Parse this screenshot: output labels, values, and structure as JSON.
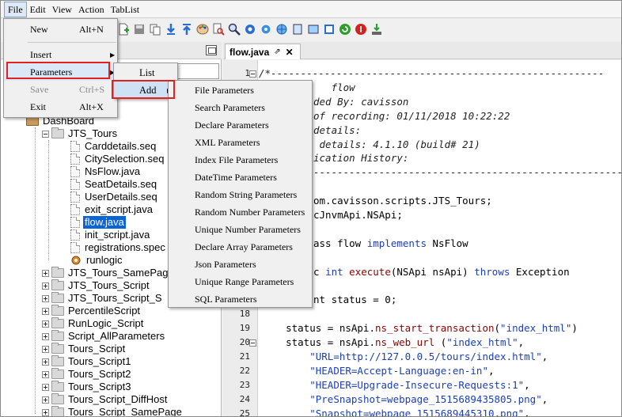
{
  "menubar": [
    "File",
    "Edit",
    "View",
    "Action",
    "TabList"
  ],
  "file_menu": {
    "items": [
      {
        "label": "New",
        "shortcut": "Alt+N",
        "enabled": true
      },
      {
        "label": "Insert",
        "shortcut": "",
        "enabled": true,
        "submenu": true
      },
      {
        "label": "Parameters",
        "shortcut": "",
        "enabled": true,
        "submenu": true,
        "highlighted": true
      },
      {
        "label": "Save",
        "shortcut": "Ctrl+S",
        "enabled": false
      },
      {
        "label": "Exit",
        "shortcut": "Alt+X",
        "enabled": true
      }
    ]
  },
  "parameters_submenu": {
    "items": [
      {
        "label": "List"
      },
      {
        "label": "Add",
        "submenu": true,
        "highlighted": true
      }
    ]
  },
  "add_submenu": {
    "items": [
      "File Parameters",
      "Search Parameters",
      "Declare Parameters",
      "XML Parameters",
      "Index File Parameters",
      "DateTime Parameters",
      "Random String Parameters",
      "Random Number Parameters",
      "Unique Number Parameters",
      "Declare Array Parameters",
      "Json Parameters",
      "Unique Range Parameters",
      "SQL Parameters"
    ]
  },
  "toolbar_icons": [
    "new-file-icon",
    "save-icon",
    "copy-icon",
    "download-icon",
    "upload-icon",
    "palette-icon",
    "search-document-icon",
    "search-icon",
    "settings-icon",
    "globe-icon",
    "web-icon",
    "document-icon",
    "image-icon",
    "message-icon",
    "refresh-icon",
    "stop-icon",
    "export-icon"
  ],
  "tree": {
    "root": "DashBoard",
    "folder": "JTS_Tours",
    "files": [
      "Carddetails.seq",
      "CitySelection.seq",
      "NsFlow.java",
      "SeatDetails.seq",
      "UserDetails.seq",
      "exit_script.java",
      "flow.java",
      "init_script.java",
      "registrations.spec",
      "runlogic"
    ],
    "selected": "flow.java",
    "other_folders": [
      "JTS_Tours_SamePage",
      "JTS_Tours_Script",
      "JTS_Tours_Script_S",
      "PercentileScript",
      "RunLogic_Script",
      "Script_AllParameters",
      "Tours_Script",
      "Tours_Script1",
      "Tours_Script2",
      "Tours_Script3",
      "Tours_Script_DiffHost",
      "Tours_Script_SamePage"
    ]
  },
  "editor": {
    "tab_title": "flow.java",
    "tab_pin": "⇗",
    "tab_close": "✕",
    "lines": [
      {
        "n": "1",
        "text": "/*--------------------------------------------------------"
      },
      {
        "n": "",
        "text": "   flow"
      },
      {
        "n": "",
        "text": "ded By: cavisson"
      },
      {
        "n": "",
        "text": "of recording: 01/11/2018 10:22:22"
      },
      {
        "n": "",
        "text": "details:"
      },
      {
        "n": "",
        "text": " details: 4.1.10 (build# 21)"
      },
      {
        "n": "",
        "text": "ication History:"
      },
      {
        "n": "",
        "text": "--------------------------------------------------------"
      },
      {
        "n": "",
        "text": ""
      },
      {
        "n": "",
        "text": "om.cavisson.scripts.JTS_Tours;"
      },
      {
        "n": "",
        "text": "cJnvmApi.NSApi;"
      },
      {
        "n": "",
        "text": ""
      },
      {
        "n": "",
        "text": "ass flow implements NsFlow"
      },
      {
        "n": "",
        "text": ""
      },
      {
        "n": "",
        "text": "c int execute(NSApi nsApi) throws Exception"
      },
      {
        "n": "",
        "text": ""
      },
      {
        "n": "",
        "text": "nt status = 0;"
      },
      {
        "n": "18",
        "text": ""
      },
      {
        "n": "19",
        "text": "    status = nsApi.ns_start_transaction(\"index_html\")"
      },
      {
        "n": "20",
        "text": "    status = nsApi.ns_web_url (\"index_html\","
      },
      {
        "n": "21",
        "text": "        \"URL=http://127.0.0.5/tours/index.html\","
      },
      {
        "n": "22",
        "text": "        \"HEADER=Accept-Language:en-in\","
      },
      {
        "n": "23",
        "text": "        \"HEADER=Upgrade-Insecure-Requests:1\","
      },
      {
        "n": "24",
        "text": "        \"PreSnapshot=webpage_1515689435805.png\","
      },
      {
        "n": "25",
        "text": "        \"Snapshot=webpage_1515689445310.png\","
      }
    ]
  }
}
